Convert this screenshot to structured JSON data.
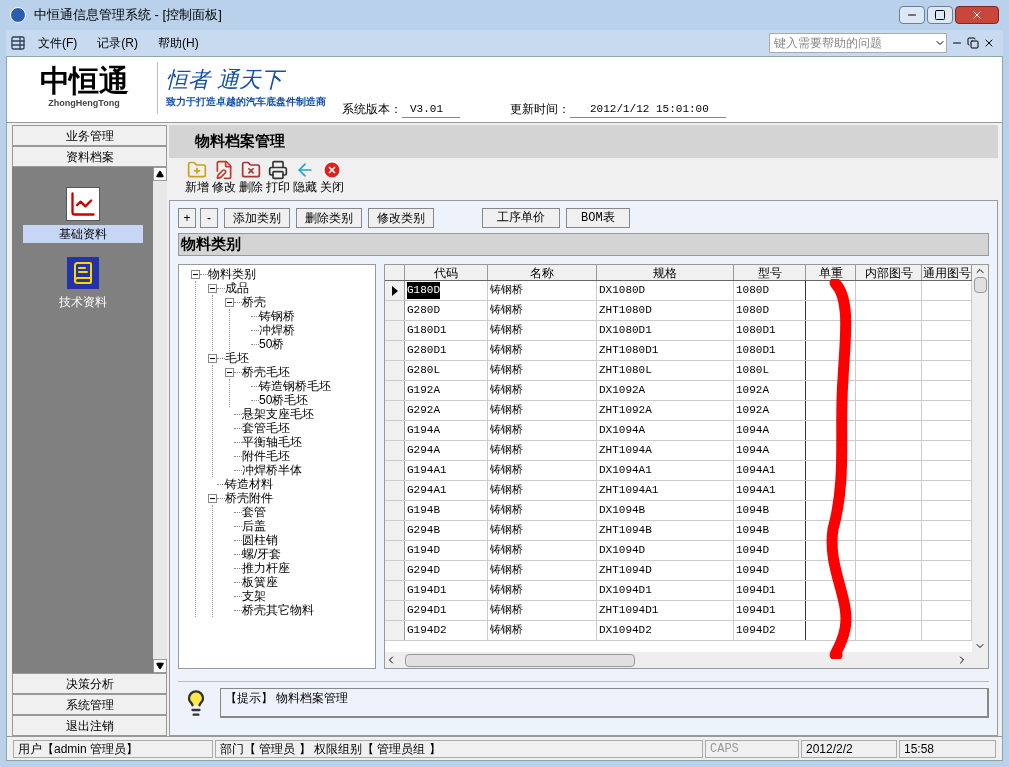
{
  "window": {
    "title": "中恒通信息管理系统 - [控制面板]"
  },
  "menu": [
    {
      "label": "文件(F)"
    },
    {
      "label": "记录(R)"
    },
    {
      "label": "帮助(H)"
    }
  ],
  "help_search": {
    "placeholder": "键入需要帮助的问题"
  },
  "header": {
    "logo": "中恒通",
    "logo_sub": "ZhongHengTong",
    "slogan": "恒者 通天下",
    "tagline": "致力于打造卓越的汽车底盘件制造商",
    "version_label": "系统版本：",
    "version": "V3.01",
    "update_label": "更新时间：",
    "update_time": "2012/1/12 15:01:00"
  },
  "sidebar": {
    "top_groups": [
      {
        "label": "业务管理"
      },
      {
        "label": "资料档案"
      }
    ],
    "items": [
      {
        "label": "基础资料",
        "kind": "chart",
        "selected": true
      },
      {
        "label": "技术资料",
        "kind": "doc",
        "selected": false
      }
    ],
    "bottom_groups": [
      {
        "label": "决策分析"
      },
      {
        "label": "系统管理"
      },
      {
        "label": "退出注销"
      }
    ]
  },
  "page_title": "物料档案管理",
  "toolbar": [
    {
      "label": "新增",
      "kind": "new"
    },
    {
      "label": "修改",
      "kind": "edit"
    },
    {
      "label": "删除",
      "kind": "delete"
    },
    {
      "label": "打印",
      "kind": "print"
    },
    {
      "label": "隐藏",
      "kind": "hide"
    },
    {
      "label": "关闭",
      "kind": "close"
    }
  ],
  "category_buttons": [
    "+",
    "-",
    "添加类别",
    "删除类别",
    "修改类别"
  ],
  "extra_buttons": [
    "工序单价",
    "BOM表"
  ],
  "section_title": "物料类别",
  "tree": [
    {
      "label": "物料类别",
      "expanded": true,
      "children": [
        {
          "label": "成品",
          "expanded": true,
          "children": [
            {
              "label": "桥壳",
              "expanded": true,
              "children": [
                {
                  "label": "铸钢桥"
                },
                {
                  "label": "冲焊桥"
                },
                {
                  "label": "50桥"
                }
              ]
            }
          ]
        },
        {
          "label": "毛坯",
          "expanded": true,
          "children": [
            {
              "label": "桥壳毛坯",
              "expanded": true,
              "children": [
                {
                  "label": "铸造钢桥毛坯"
                },
                {
                  "label": "50桥毛坯"
                }
              ]
            },
            {
              "label": "悬架支座毛坯"
            },
            {
              "label": "套管毛坯"
            },
            {
              "label": "平衡轴毛坯"
            },
            {
              "label": "附件毛坯"
            },
            {
              "label": "冲焊桥半体"
            }
          ]
        },
        {
          "label": "铸造材料"
        },
        {
          "label": "桥壳附件",
          "expanded": true,
          "children": [
            {
              "label": "套管"
            },
            {
              "label": "后盖"
            },
            {
              "label": "圆柱销"
            },
            {
              "label": "螺/牙套"
            },
            {
              "label": "推力杆座"
            },
            {
              "label": "板簧座"
            },
            {
              "label": "支架"
            },
            {
              "label": "桥壳其它物料"
            }
          ]
        }
      ]
    }
  ],
  "table": {
    "columns": [
      "代码",
      "名称",
      "规格",
      "型号",
      "单重",
      "内部图号",
      "通用图号"
    ],
    "rows": [
      {
        "cells": [
          "G180D",
          "铸钢桥",
          "DX1080D",
          "1080D"
        ],
        "selected": true
      },
      {
        "cells": [
          "G280D",
          "铸钢桥",
          "ZHT1080D",
          "1080D"
        ],
        "selected": false
      },
      {
        "cells": [
          "G180D1",
          "铸钢桥",
          "DX1080D1",
          "1080D1"
        ],
        "selected": false
      },
      {
        "cells": [
          "G280D1",
          "铸钢桥",
          "ZHT1080D1",
          "1080D1"
        ],
        "selected": false
      },
      {
        "cells": [
          "G280L",
          "铸钢桥",
          "ZHT1080L",
          "1080L"
        ],
        "selected": false
      },
      {
        "cells": [
          "G192A",
          "铸钢桥",
          "DX1092A",
          "1092A"
        ],
        "selected": false
      },
      {
        "cells": [
          "G292A",
          "铸钢桥",
          "ZHT1092A",
          "1092A"
        ],
        "selected": false
      },
      {
        "cells": [
          "G194A",
          "铸钢桥",
          "DX1094A",
          "1094A"
        ],
        "selected": false
      },
      {
        "cells": [
          "G294A",
          "铸钢桥",
          "ZHT1094A",
          "1094A"
        ],
        "selected": false
      },
      {
        "cells": [
          "G194A1",
          "铸钢桥",
          "DX1094A1",
          "1094A1"
        ],
        "selected": false
      },
      {
        "cells": [
          "G294A1",
          "铸钢桥",
          "ZHT1094A1",
          "1094A1"
        ],
        "selected": false
      },
      {
        "cells": [
          "G194B",
          "铸钢桥",
          "DX1094B",
          "1094B"
        ],
        "selected": false
      },
      {
        "cells": [
          "G294B",
          "铸钢桥",
          "ZHT1094B",
          "1094B"
        ],
        "selected": false
      },
      {
        "cells": [
          "G194D",
          "铸钢桥",
          "DX1094D",
          "1094D"
        ],
        "selected": false
      },
      {
        "cells": [
          "G294D",
          "铸钢桥",
          "ZHT1094D",
          "1094D"
        ],
        "selected": false
      },
      {
        "cells": [
          "G194D1",
          "铸钢桥",
          "DX1094D1",
          "1094D1"
        ],
        "selected": false
      },
      {
        "cells": [
          "G294D1",
          "铸钢桥",
          "ZHT1094D1",
          "1094D1"
        ],
        "selected": false
      },
      {
        "cells": [
          "G194D2",
          "铸钢桥",
          "DX1094D2",
          "1094D2"
        ],
        "selected": false
      }
    ]
  },
  "hint": "【提示】 物料档案管理",
  "status_bar": [
    "用户【admin 管理员】",
    "部门【 管理员 】 权限组别【 管理员组 】",
    "CAPS",
    "2012/2/2",
    "15:58"
  ]
}
